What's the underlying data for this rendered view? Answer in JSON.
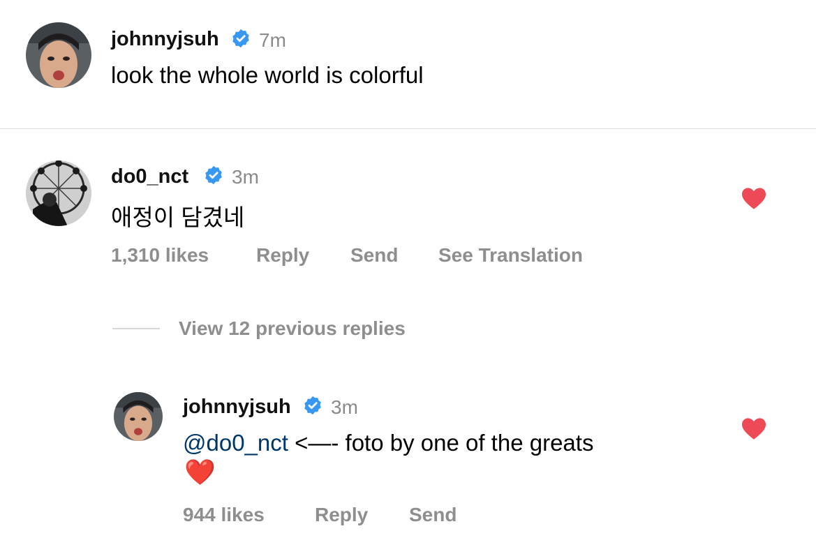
{
  "colors": {
    "verified": "#3897f0",
    "like_red": "#ed4956",
    "meta_gray": "#8e8e8e",
    "mention": "#00376b"
  },
  "post": {
    "username": "johnnyjsuh",
    "time": "7m",
    "caption": "look the whole world is colorful"
  },
  "comment": {
    "username": "do0_nct",
    "time": "3m",
    "text": "애정이 담겼네",
    "likes": "1,310 likes",
    "reply_label": "Reply",
    "send_label": "Send",
    "translate_label": "See Translation",
    "liked": true
  },
  "view_replies": "View 12 previous replies",
  "reply": {
    "username": "johnnyjsuh",
    "time": "3m",
    "mention": "@do0_nct",
    "text": " <—- foto by one of the greats",
    "emoji": "❤️",
    "likes": "944 likes",
    "reply_label": "Reply",
    "send_label": "Send",
    "liked": true
  },
  "icons": {
    "verified": "verified-badge-icon",
    "like": "heart-icon"
  }
}
